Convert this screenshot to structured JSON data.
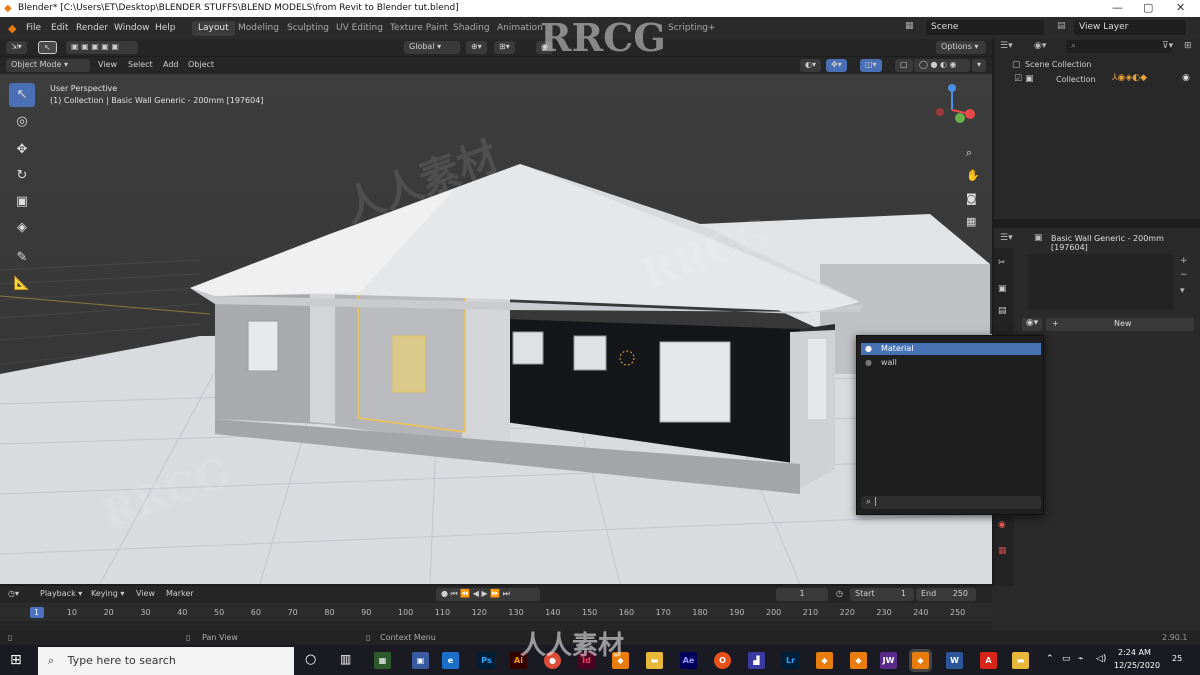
{
  "window": {
    "title": "Blender* [C:\\Users\\ET\\Desktop\\BLENDER STUFFS\\BLEND MODELS\\from Revit to  Blender tut.blend]"
  },
  "menu": [
    "File",
    "Edit",
    "Render",
    "Window",
    "Help"
  ],
  "workspaces": [
    "Layout",
    "Modeling",
    "Sculpting",
    "UV Editing",
    "Texture Paint",
    "Shading",
    "Animation"
  ],
  "workspace_extra": [
    "Scripting"
  ],
  "scene": {
    "label": "Scene",
    "view_layer": "View Layer"
  },
  "viewport": {
    "mode": "Object Mode",
    "menus": [
      "View",
      "Select",
      "Add",
      "Object"
    ],
    "orientation": "Global",
    "options": "Options",
    "perspective": "User Perspective",
    "object_info": "(1) Collection | Basic Wall Generic - 200mm [197604]"
  },
  "outliner": {
    "scene_collection": "Scene Collection",
    "collection": "Collection"
  },
  "properties": {
    "object_name": "Basic Wall Generic - 200mm [197604]",
    "new_button": "New"
  },
  "material_popup": {
    "items": [
      "Material",
      "wall"
    ],
    "search_value": ""
  },
  "timeline": {
    "menus": [
      "Playback",
      "Keying",
      "View",
      "Marker"
    ],
    "current_frame": "1",
    "start_label": "Start",
    "start": "1",
    "end_label": "End",
    "end": "250",
    "frames": [
      "1",
      "10",
      "20",
      "30",
      "40",
      "50",
      "60",
      "70",
      "80",
      "90",
      "100",
      "110",
      "120",
      "130",
      "140",
      "150",
      "160",
      "170",
      "180",
      "190",
      "200",
      "210",
      "220",
      "230",
      "240",
      "250"
    ]
  },
  "status": {
    "pan": "Pan View",
    "context": "Context Menu",
    "version": "2.90.1"
  },
  "taskbar": {
    "search_placeholder": "Type here to search",
    "time": "2:24 AM",
    "date": "12/25/2020",
    "notif": "25"
  },
  "watermarks": [
    "RRCG",
    "人人素材"
  ]
}
